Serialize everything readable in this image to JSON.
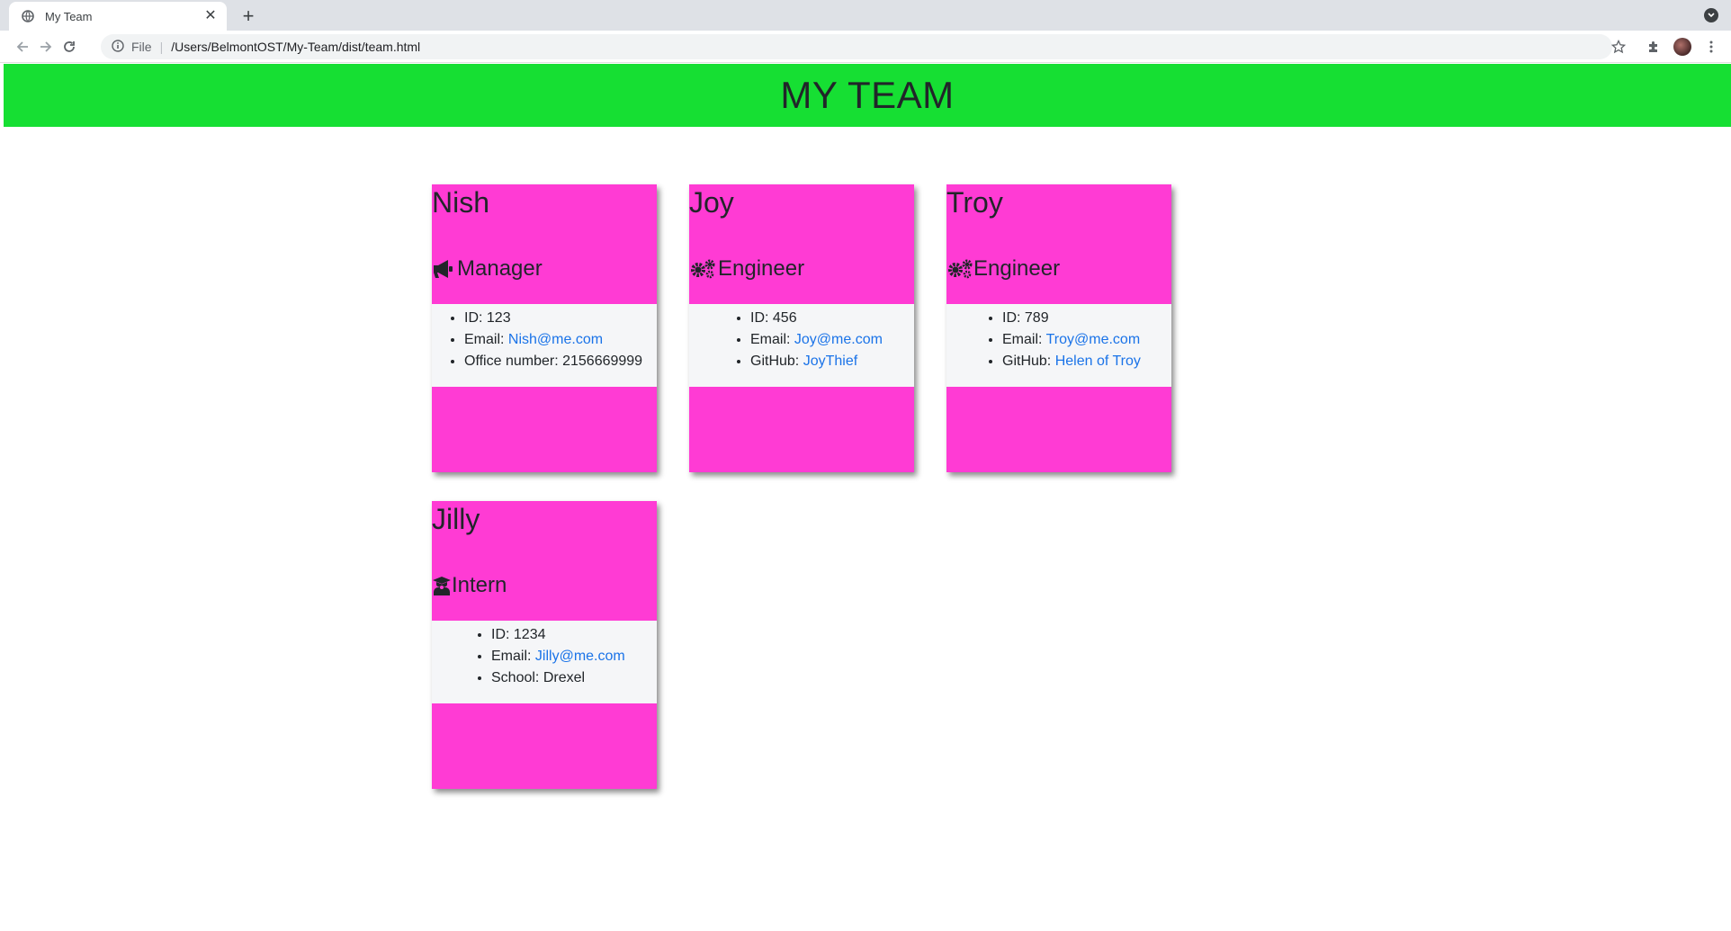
{
  "browser": {
    "tab_title": "My Team",
    "address_scheme": "File",
    "address_url": "/Users/BelmontOST/My-Team/dist/team.html"
  },
  "page": {
    "heading": "MY TEAM"
  },
  "colors": {
    "header_bg": "#16df33",
    "card_bg": "#ff3bd4",
    "info_bg": "#f5f6f8",
    "link": "#1a73e8"
  },
  "cards": [
    {
      "name": "Nish",
      "role": "Manager",
      "role_icon": "megaphone-icon",
      "id_label": "ID: ",
      "id": "123",
      "email_label": "Email: ",
      "email": "Nish@me.com",
      "extra_label": "Office number: ",
      "extra": "2156669999"
    },
    {
      "name": "Joy",
      "role": "Engineer",
      "role_icon": "gears-icon",
      "id_label": "ID: ",
      "id": "456",
      "email_label": "Email: ",
      "email": "Joy@me.com",
      "extra_label": "GitHub: ",
      "extra": "JoyThief"
    },
    {
      "name": "Troy",
      "role": "Engineer",
      "role_icon": "gears-icon",
      "id_label": "ID: ",
      "id": "789",
      "email_label": "Email: ",
      "email": "Troy@me.com",
      "extra_label": "GitHub: ",
      "extra": "Helen of Troy"
    },
    {
      "name": "Jilly",
      "role": "Intern",
      "role_icon": "graduate-icon",
      "id_label": "ID: ",
      "id": "1234",
      "email_label": "Email: ",
      "email": "Jilly@me.com",
      "extra_label": "School: ",
      "extra": "Drexel"
    }
  ]
}
